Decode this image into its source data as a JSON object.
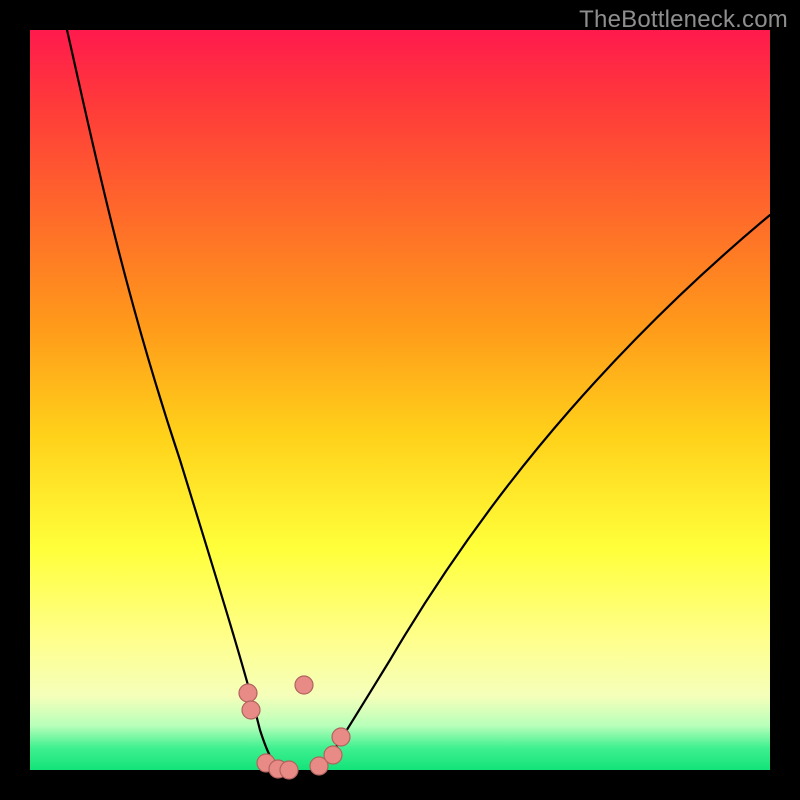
{
  "watermark": "TheBottleneck.com",
  "colors": {
    "frame": "#000000",
    "curve": "#000000",
    "points_fill": "#e88a86",
    "points_stroke": "#b0645f"
  },
  "chart_data": {
    "type": "line",
    "title": "",
    "xlabel": "",
    "ylabel": "",
    "xlim": [
      0,
      100
    ],
    "ylim": [
      0,
      100
    ],
    "curve_left": {
      "x": [
        5,
        8,
        12,
        16,
        20,
        23,
        25,
        27,
        28.5,
        30,
        31.5,
        33
      ],
      "y": [
        100,
        85,
        68,
        51,
        36,
        24,
        16,
        10,
        6,
        3,
        1,
        0
      ]
    },
    "curve_right": {
      "x": [
        40,
        42,
        45,
        50,
        55,
        60,
        66,
        72,
        80,
        88,
        95,
        100
      ],
      "y": [
        0,
        3,
        7,
        14,
        21,
        29,
        38,
        47,
        57,
        66,
        72,
        76
      ]
    },
    "points": [
      {
        "x": 29.5,
        "y": 10.5
      },
      {
        "x": 29.8,
        "y": 8.2
      },
      {
        "x": 31.8,
        "y": 1.0
      },
      {
        "x": 33.5,
        "y": 0.2
      },
      {
        "x": 35.0,
        "y": 0.0
      },
      {
        "x": 39.0,
        "y": 0.5
      },
      {
        "x": 41.0,
        "y": 2.0
      },
      {
        "x": 42.0,
        "y": 4.5
      },
      {
        "x": 37.0,
        "y": 11.5
      }
    ],
    "gradient_meaning": "green = low bottleneck, red = high bottleneck",
    "note": "axes unlabeled in source image; values normalized 0–100"
  }
}
